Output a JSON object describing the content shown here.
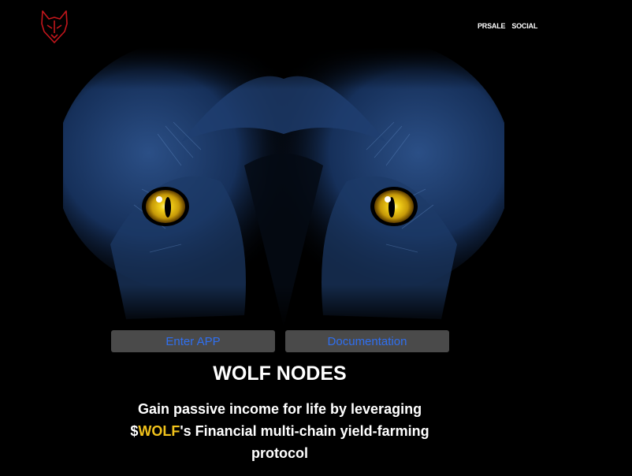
{
  "header": {
    "logo_icon": "wolf-head-icon",
    "nav": [
      {
        "label": "PRSALE"
      },
      {
        "label": "SOCIAL"
      }
    ]
  },
  "hero": {
    "image": "wolf-eyes-illustration"
  },
  "buttons": {
    "enter_app": "Enter APP",
    "documentation": "Documentation"
  },
  "main": {
    "title": "WOLF NODES",
    "tagline_line1": "Gain passive income for life by leveraging",
    "tagline_dollar": "$",
    "tagline_token": "WOLF",
    "tagline_rest": "'s Financial multi-chain yield-farming",
    "tagline_line3": "protocol"
  },
  "colors": {
    "background": "#000000",
    "button_bg": "#4a4a4a",
    "button_text": "#2f6ff0",
    "accent": "#f1c21b",
    "logo": "#c4161c"
  }
}
